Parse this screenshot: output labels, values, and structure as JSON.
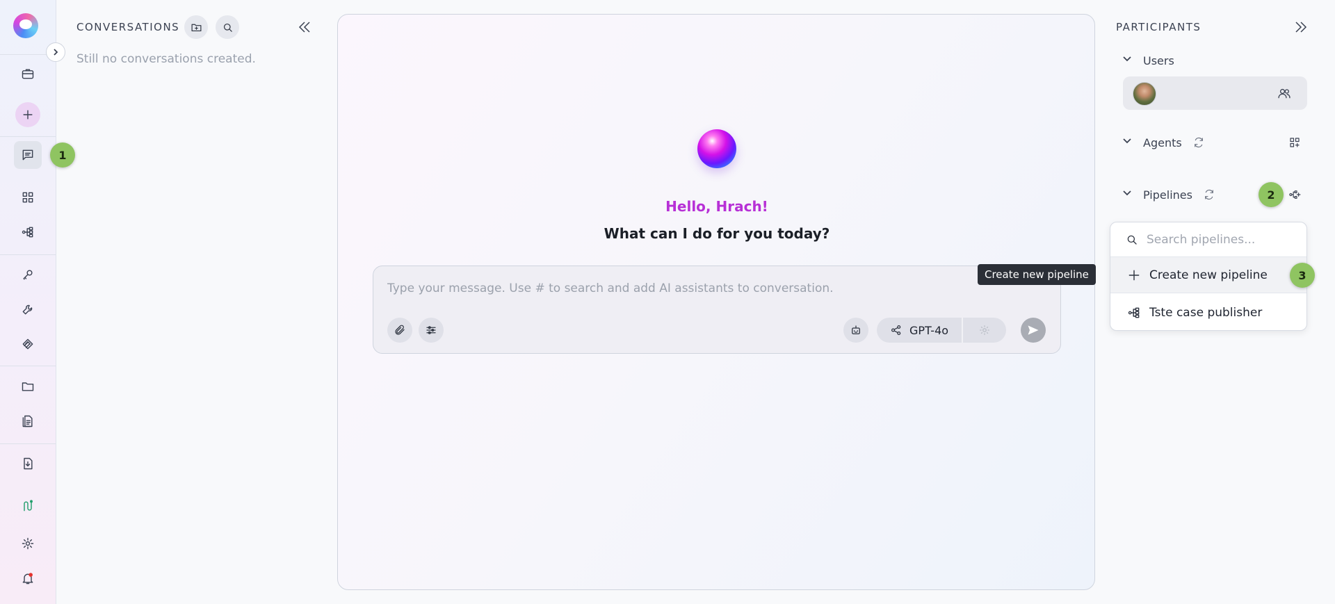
{
  "rail": {
    "items": [
      "briefcase-icon",
      "new-chat-icon",
      "chat-icon",
      "apps-icon",
      "pipelines-icon",
      "key-icon",
      "wrench-icon",
      "prompts-icon",
      "folder-icon",
      "files-icon",
      "import-icon",
      "brand-icon",
      "settings-icon",
      "notifications-icon"
    ]
  },
  "badges": {
    "one": "1",
    "two": "2",
    "three": "3"
  },
  "conversations": {
    "title": "CONVERSATIONS",
    "empty": "Still no conversations created."
  },
  "chat": {
    "greeting": "Hello, Hrach!",
    "question": "What can I do for you today?",
    "placeholder": "Type your message. Use # to search and add AI assistants to conversation.",
    "model": "GPT-4o"
  },
  "tooltip": "Create new pipeline",
  "participants": {
    "title": "PARTICIPANTS",
    "users_label": "Users",
    "agents_label": "Agents",
    "pipelines_label": "Pipelines",
    "pipeline_search_placeholder": "Search pipelines...",
    "create_pipeline_label": "Create new pipeline",
    "pipeline_items": [
      "Tste case publisher"
    ]
  },
  "colors": {
    "accent_greeting": "#b730d6",
    "badge": "#8fc461",
    "tooltip_bg": "#2b2f37"
  }
}
